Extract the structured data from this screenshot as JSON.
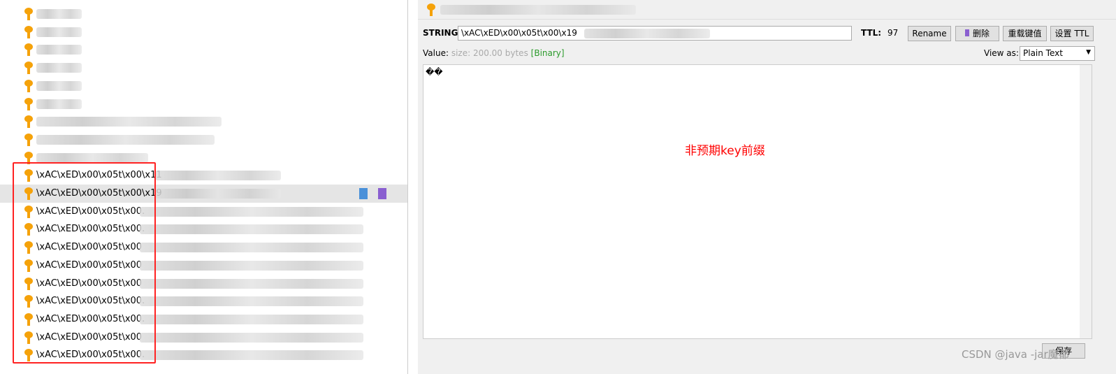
{
  "key_tree": {
    "rows": [
      {
        "label": ""
      },
      {
        "label": ""
      },
      {
        "label": ""
      },
      {
        "label": ""
      },
      {
        "label": ""
      },
      {
        "label": ""
      },
      {
        "label": ""
      },
      {
        "label": ""
      },
      {
        "label": ""
      },
      {
        "label": "\\xAC\\xED\\x00\\x05t\\x00\\x11"
      },
      {
        "label": "\\xAC\\xED\\x00\\x05t\\x00\\x19",
        "selected": true
      },
      {
        "label": "\\xAC\\xED\\x00\\x05t\\x00."
      },
      {
        "label": "\\xAC\\xED\\x00\\x05t\\x00."
      },
      {
        "label": "\\xAC\\xED\\x00\\x05t\\x00"
      },
      {
        "label": "\\xAC\\xED\\x00\\x05t\\x00"
      },
      {
        "label": "\\xAC\\xED\\x00\\x05t\\x00"
      },
      {
        "label": "\\xAC\\xED\\x00\\x05t\\x00."
      },
      {
        "label": "\\xAC\\xED\\x00\\x05t\\x00."
      },
      {
        "label": "\\xAC\\xED\\x00\\x05t\\x00"
      },
      {
        "label": "\\xAC\\xED\\x00\\x05t\\x00."
      }
    ]
  },
  "detail": {
    "type_label": "STRING:",
    "key_value": "\\xAC\\xED\\x00\\x05t\\x00\\x19",
    "ttl_label": "TTL:",
    "ttl_value": "97",
    "buttons": {
      "rename": "Rename",
      "delete": "删除",
      "reload": "重载键值",
      "set_ttl": "设置 TTL"
    },
    "value_label": "Value:",
    "size": "size: 200.00 bytes",
    "binary": "[Binary]",
    "view_as_label": "View as:",
    "view_as": "Plain Text",
    "content": "��",
    "save": "保存"
  },
  "annotation": "非预期key前缀",
  "watermark": "CSDN @java -jar魔都",
  "colors": {
    "annotation": "#ff0000",
    "highlight_box": "#ff2222",
    "key_icon": "#f5a20a",
    "binary": "#2a9a2a"
  }
}
